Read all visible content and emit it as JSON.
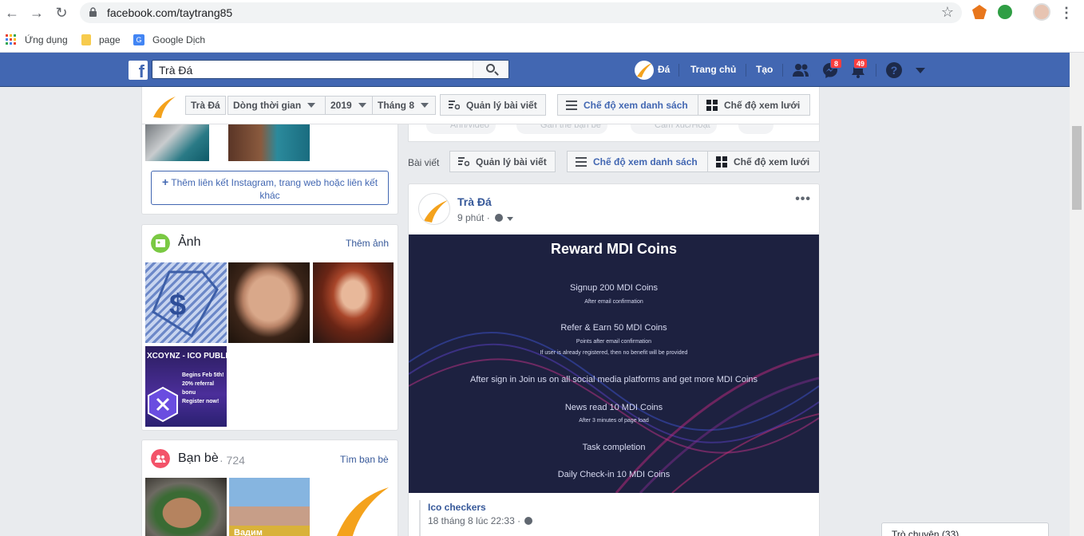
{
  "browser": {
    "url": "facebook.com/taytrang85",
    "bookmarks": [
      "Ứng dụng",
      "page",
      "Google Dịch"
    ]
  },
  "fb": {
    "search_value": "Trà Đá",
    "profile_short": "Đá",
    "nav_home": "Trang chủ",
    "nav_create": "Tạo",
    "messenger_badge": "8",
    "notif_badge": "49"
  },
  "sticky": {
    "name": "Trà Đá",
    "timeline": "Dòng thời gian",
    "year": "2019",
    "month": "Tháng 8",
    "manage": "Quản lý bài viết",
    "list_view": "Chế độ xem danh sách",
    "grid_view": "Chế độ xem lưới"
  },
  "left": {
    "add_link": "Thêm liên kết Instagram, trang web hoặc liên kết khác",
    "photos_title": "Ảnh",
    "photos_more": "Thêm ảnh",
    "xcoynz": {
      "title": "XCOYNZ - ICO PUBLI",
      "l1": "Begins Feb 5th!",
      "l2": "20% referral bonu",
      "l3": "Register now!"
    },
    "friends_title": "Bạn bè",
    "friends_count": "· 724",
    "friends_find": "Tìm bạn bè",
    "friend_name": "Вадим"
  },
  "feed": {
    "ghost1": "Ảnh/video",
    "ghost2": "Gắn thẻ bạn bè",
    "ghost3": "Cảm xúc/Hoạt",
    "posts_label": "Bài viết",
    "manage": "Quản lý bài viết",
    "list_view": "Chế độ xem danh sách",
    "grid_view": "Chế độ xem lưới"
  },
  "post": {
    "author": "Trà Đá",
    "time": "9 phút ·",
    "promo": {
      "title": "Reward MDI Coins",
      "l1": "Signup 200 MDI Coins",
      "l1s": "After email confirmation",
      "l2": "Refer & Earn 50 MDI Coins",
      "l2s": "Points after email confirmation",
      "l2s2": "If user is already registered, then no benefit will be provided",
      "l3": "After sign in Join us on all social media platforms and get more MDI Coins",
      "l4": "News read 10 MDI Coins",
      "l4s": "After 3 minutes of page load",
      "l5": "Task completion",
      "l6": "Daily Check-in 10 MDI Coins"
    },
    "shared_name": "Ico checkers",
    "shared_time": "18 tháng 8 lúc 22:33 ·"
  },
  "chat": {
    "label": "Trò chuyện (33)"
  },
  "colors": {
    "fb_blue": "#4267b2",
    "link": "#365899",
    "promo_bg": "#1d2140"
  }
}
